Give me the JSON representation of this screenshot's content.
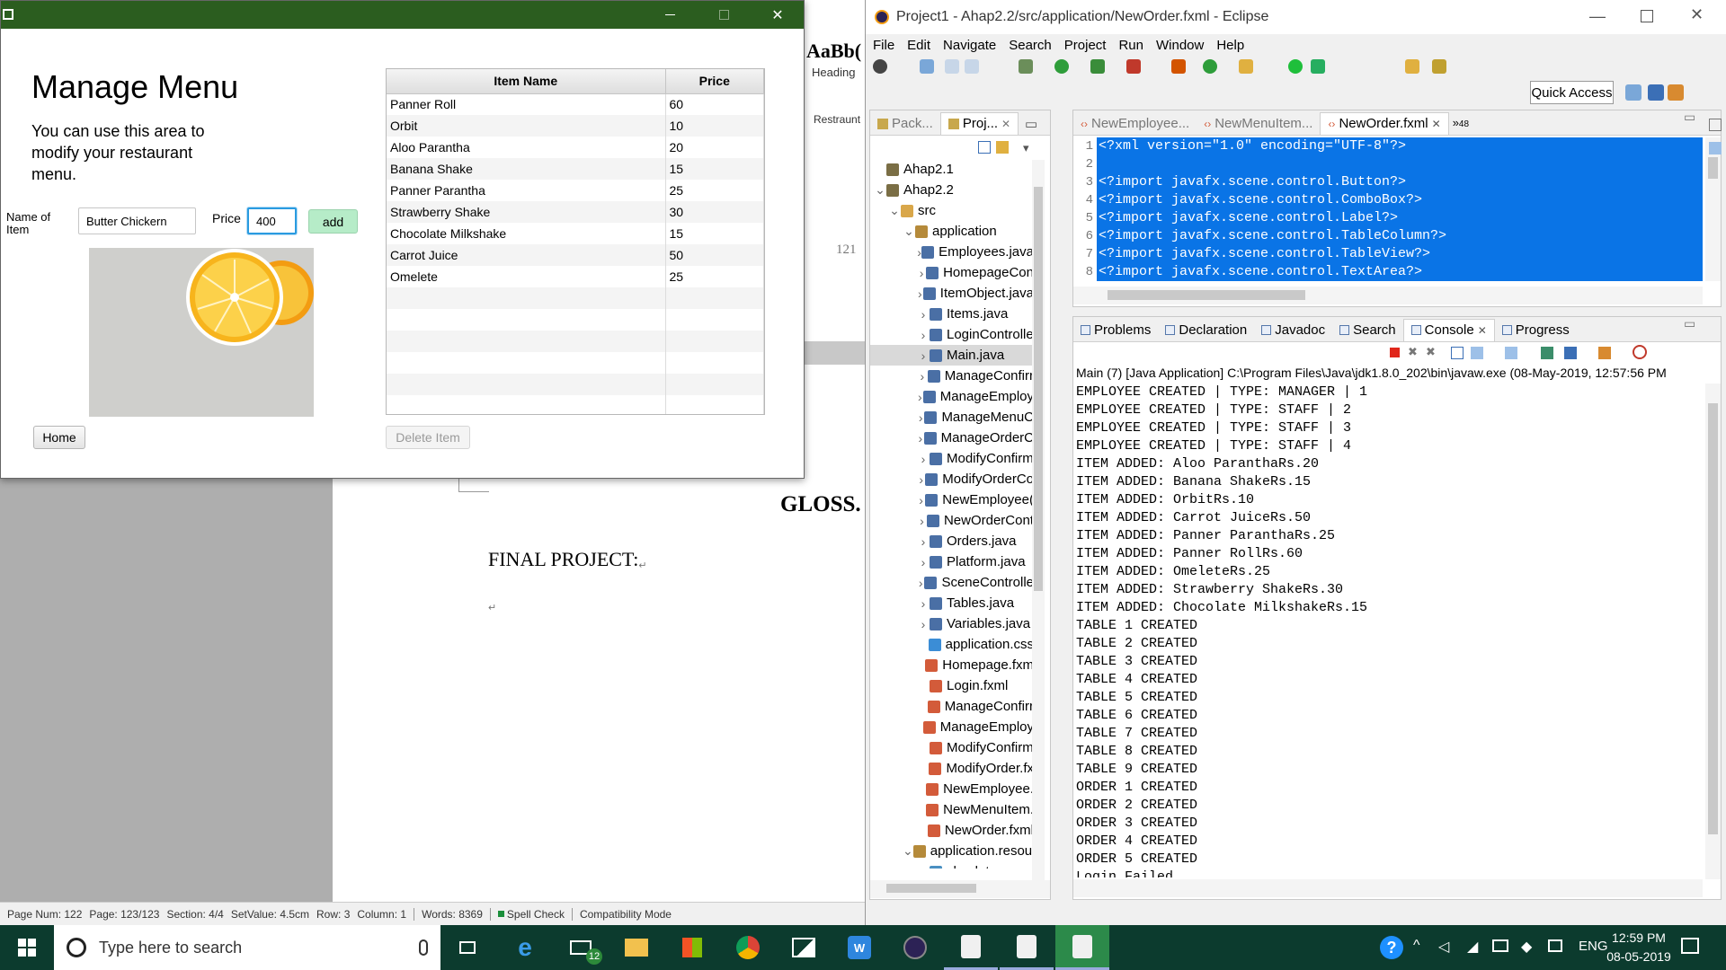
{
  "word": {
    "style_preview": "AaBb(",
    "style_name": "Heading",
    "sidebar_label": "Restraunt",
    "margin_number": "121",
    "glossary": "GLOSS.",
    "final_project": "FINAL PROJECT:",
    "para_mark": "↵",
    "status": [
      "Page Num: 122",
      "Page: 123/123",
      "Section: 4/4",
      "SetValue: 4.5cm",
      "Row: 3",
      "Column: 1",
      "Words: 8369",
      "Spell Check",
      "Compatibility Mode"
    ]
  },
  "fx": {
    "title": "Manage Menu",
    "description": "You can use this area to modify your restaurant menu.",
    "name_label": "Name of Item",
    "name_value": "Butter Chickern",
    "price_label": "Price",
    "price_value": "400",
    "add_label": "add",
    "home_label": "Home",
    "delete_label": "Delete Item",
    "columns": [
      "Item Name",
      "Price"
    ],
    "rows": [
      [
        "Panner Roll",
        "60"
      ],
      [
        "Orbit",
        "10"
      ],
      [
        "Aloo Parantha",
        "20"
      ],
      [
        "Banana Shake",
        "15"
      ],
      [
        "Panner Parantha",
        "25"
      ],
      [
        "Strawberry Shake",
        "30"
      ],
      [
        "Chocolate Milkshake",
        "15"
      ],
      [
        "Carrot Juice",
        "50"
      ],
      [
        "Omelete",
        "25"
      ],
      [
        "",
        ""
      ],
      [
        "",
        ""
      ],
      [
        "",
        ""
      ],
      [
        "",
        ""
      ],
      [
        "",
        ""
      ],
      [
        "",
        ""
      ]
    ]
  },
  "eclipse": {
    "title": "Project1 - Ahap2.2/src/application/NewOrder.fxml - Eclipse",
    "menu": [
      "File",
      "Edit",
      "Navigate",
      "Search",
      "Project",
      "Run",
      "Window",
      "Help"
    ],
    "quick_access": "Quick Access",
    "explorer_tabs": [
      "Pack...",
      "Proj..."
    ],
    "tree": [
      {
        "label": "Ahap2.1",
        "indent": 0,
        "arrow": "",
        "icon": "project"
      },
      {
        "label": "Ahap2.2",
        "indent": 0,
        "arrow": "v",
        "icon": "project"
      },
      {
        "label": "src",
        "indent": 1,
        "arrow": "v",
        "icon": "folder"
      },
      {
        "label": "application",
        "indent": 2,
        "arrow": "v",
        "icon": "package"
      },
      {
        "label": "Employees.java",
        "indent": 3,
        "arrow": ">",
        "icon": "java"
      },
      {
        "label": "HomepageCon",
        "indent": 3,
        "arrow": ">",
        "icon": "java"
      },
      {
        "label": "ItemObject.java",
        "indent": 3,
        "arrow": ">",
        "icon": "java"
      },
      {
        "label": "Items.java",
        "indent": 3,
        "arrow": ">",
        "icon": "java"
      },
      {
        "label": "LoginControlle",
        "indent": 3,
        "arrow": ">",
        "icon": "java"
      },
      {
        "label": "Main.java",
        "indent": 3,
        "arrow": ">",
        "icon": "java",
        "selected": true
      },
      {
        "label": "ManageConfirr",
        "indent": 3,
        "arrow": ">",
        "icon": "java"
      },
      {
        "label": "ManageEmploy",
        "indent": 3,
        "arrow": ">",
        "icon": "java"
      },
      {
        "label": "ManageMenuC",
        "indent": 3,
        "arrow": ">",
        "icon": "java"
      },
      {
        "label": "ManageOrderC",
        "indent": 3,
        "arrow": ">",
        "icon": "java"
      },
      {
        "label": "ModifyConfirm",
        "indent": 3,
        "arrow": ">",
        "icon": "java"
      },
      {
        "label": "ModifyOrderCo",
        "indent": 3,
        "arrow": ">",
        "icon": "java"
      },
      {
        "label": "NewEmployee(",
        "indent": 3,
        "arrow": ">",
        "icon": "java"
      },
      {
        "label": "NewOrderCont",
        "indent": 3,
        "arrow": ">",
        "icon": "java"
      },
      {
        "label": "Orders.java",
        "indent": 3,
        "arrow": ">",
        "icon": "java"
      },
      {
        "label": "Platform.java",
        "indent": 3,
        "arrow": ">",
        "icon": "java"
      },
      {
        "label": "SceneControlle",
        "indent": 3,
        "arrow": ">",
        "icon": "java"
      },
      {
        "label": "Tables.java",
        "indent": 3,
        "arrow": ">",
        "icon": "java"
      },
      {
        "label": "Variables.java",
        "indent": 3,
        "arrow": ">",
        "icon": "java"
      },
      {
        "label": "application.css",
        "indent": 3,
        "arrow": "",
        "icon": "css"
      },
      {
        "label": "Homepage.fxm",
        "indent": 3,
        "arrow": "",
        "icon": "fxml"
      },
      {
        "label": "Login.fxml",
        "indent": 3,
        "arrow": "",
        "icon": "fxml"
      },
      {
        "label": "ManageConfirr",
        "indent": 3,
        "arrow": "",
        "icon": "fxml"
      },
      {
        "label": "ManageEmploy",
        "indent": 3,
        "arrow": "",
        "icon": "fxml"
      },
      {
        "label": "ModifyConfirm",
        "indent": 3,
        "arrow": "",
        "icon": "fxml"
      },
      {
        "label": "ModifyOrder.fx",
        "indent": 3,
        "arrow": "",
        "icon": "fxml"
      },
      {
        "label": "NewEmployee.",
        "indent": 3,
        "arrow": "",
        "icon": "fxml"
      },
      {
        "label": "NewMenuItem.",
        "indent": 3,
        "arrow": "",
        "icon": "fxml"
      },
      {
        "label": "NewOrder.fxml",
        "indent": 3,
        "arrow": "",
        "icon": "fxml"
      },
      {
        "label": "application.resour",
        "indent": 2,
        "arrow": "v",
        "icon": "package"
      },
      {
        "label": "choclate.png",
        "indent": 3,
        "arrow": "",
        "icon": "image"
      }
    ],
    "editor_tabs": [
      "NewEmployee...",
      "NewMenuItem...",
      "NewOrder.fxml"
    ],
    "editor_overflow": "»",
    "editor_overflow_count": "48",
    "editor_lines": [
      {
        "n": "1",
        "t": "<?xml version=\"1.0\" encoding=\"UTF-8\"?>"
      },
      {
        "n": "2",
        "t": ""
      },
      {
        "n": "3",
        "t": "<?import javafx.scene.control.Button?>"
      },
      {
        "n": "4",
        "t": "<?import javafx.scene.control.ComboBox?>"
      },
      {
        "n": "5",
        "t": "<?import javafx.scene.control.Label?>"
      },
      {
        "n": "6",
        "t": "<?import javafx.scene.control.TableColumn?>"
      },
      {
        "n": "7",
        "t": "<?import javafx.scene.control.TableView?>"
      },
      {
        "n": "8",
        "t": "<?import javafx.scene.control.TextArea?>"
      }
    ],
    "bottom_tabs": [
      "Problems",
      "Declaration",
      "Javadoc",
      "Search",
      "Console",
      "Progress"
    ],
    "console_header": "Main (7) [Java Application] C:\\Program Files\\Java\\jdk1.8.0_202\\bin\\javaw.exe (08-May-2019, 12:57:56 PM",
    "console_lines": [
      "EMPLOYEE CREATED | TYPE: MANAGER | 1",
      "EMPLOYEE CREATED | TYPE: STAFF | 2",
      "EMPLOYEE CREATED | TYPE: STAFF | 3",
      "EMPLOYEE CREATED | TYPE: STAFF | 4",
      "ITEM ADDED: Aloo ParanthaRs.20",
      "ITEM ADDED: Banana ShakeRs.15",
      "ITEM ADDED: OrbitRs.10",
      "ITEM ADDED: Carrot JuiceRs.50",
      "ITEM ADDED: Panner ParanthaRs.25",
      "ITEM ADDED: Panner RollRs.60",
      "ITEM ADDED: OmeleteRs.25",
      "ITEM ADDED: Strawberry ShakeRs.30",
      "ITEM ADDED: Chocolate MilkshakeRs.15",
      "TABLE 1 CREATED",
      "TABLE 2 CREATED",
      "TABLE 3 CREATED",
      "TABLE 4 CREATED",
      "TABLE 5 CREATED",
      "TABLE 6 CREATED",
      "TABLE 7 CREATED",
      "TABLE 8 CREATED",
      "TABLE 9 CREATED",
      "ORDER 1 CREATED",
      "ORDER 2 CREATED",
      "ORDER 3 CREATED",
      "ORDER 4 CREATED",
      "ORDER 5 CREATED",
      "Login Failed"
    ]
  },
  "taskbar": {
    "search_placeholder": "Type here to search",
    "mail_badge": "12",
    "lang": "ENG",
    "time": "12:59 PM",
    "date": "08-05-2019"
  },
  "colors": {
    "fx_title": "#2b5d1f",
    "selection": "#0a74e6",
    "taskbar": "#0c3b2e",
    "add_button": "#b6ecc8"
  }
}
